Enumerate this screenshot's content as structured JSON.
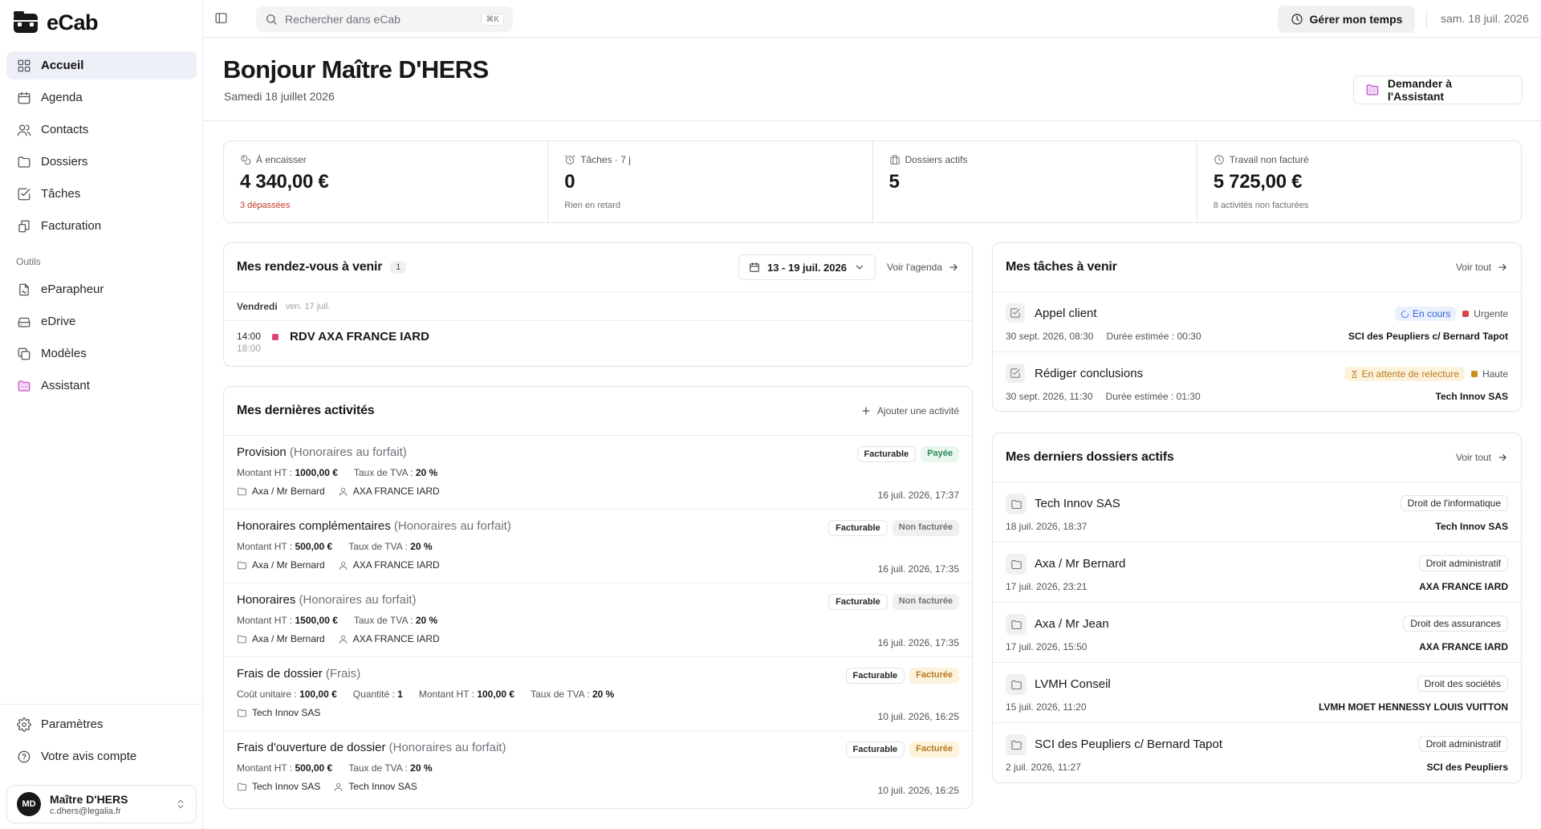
{
  "app": {
    "name": "eCab"
  },
  "sidebar": {
    "nav": [
      {
        "label": "Accueil",
        "icon": "dashboard-icon",
        "active": true
      },
      {
        "label": "Agenda",
        "icon": "calendar-icon"
      },
      {
        "label": "Contacts",
        "icon": "users-icon"
      },
      {
        "label": "Dossiers",
        "icon": "folder-icon"
      },
      {
        "label": "Tâches",
        "icon": "check-square-icon"
      },
      {
        "label": "Facturation",
        "icon": "invoice-icon"
      }
    ],
    "tools_label": "Outils",
    "tools": [
      {
        "label": "eParapheur",
        "icon": "signature-icon"
      },
      {
        "label": "eDrive",
        "icon": "drive-icon"
      },
      {
        "label": "Modèles",
        "icon": "copy-icon"
      },
      {
        "label": "Assistant",
        "icon": "assistant-icon"
      }
    ],
    "bottom": [
      {
        "label": "Paramètres",
        "icon": "gear-icon"
      },
      {
        "label": "Votre avis compte",
        "icon": "help-circle-icon"
      }
    ],
    "user": {
      "initials": "MD",
      "name": "Maître D'HERS",
      "email": "c.dhers@legalia.fr"
    }
  },
  "topbar": {
    "search_placeholder": "Rechercher dans eCab",
    "search_shortcut": "⌘K",
    "time_button": "Gérer mon temps",
    "date": "sam. 18 juil. 2026"
  },
  "header": {
    "title": "Bonjour Maître D'HERS",
    "subtitle": "Samedi 18 juillet 2026",
    "assistant_button": "Demander à l'Assistant"
  },
  "stats": [
    {
      "label": "À encaisser",
      "value": "4 340,00 €",
      "sub": "3 dépassées",
      "sub_style": "danger",
      "icon": "coins-icon"
    },
    {
      "label": "Tâches · 7 j",
      "value": "0",
      "sub": "Rien en retard",
      "sub_style": "normal",
      "icon": "alarm-clock-icon"
    },
    {
      "label": "Dossiers actifs",
      "value": "5",
      "sub": "",
      "sub_style": "normal",
      "icon": "briefcase-icon"
    },
    {
      "label": "Travail non facturé",
      "value": "5 725,00 €",
      "sub": "8 activités non facturées",
      "sub_style": "normal",
      "icon": "clock-icon"
    }
  ],
  "appointments": {
    "title": "Mes rendez-vous à venir",
    "count": "1",
    "range": "13 - 19 juil. 2026",
    "link": "Voir l'agenda",
    "day_name": "Vendredi",
    "day_date": "ven. 17 juil.",
    "items": [
      {
        "start": "14:00",
        "end": "18:00",
        "title": "RDV AXA FRANCE IARD",
        "color": "#e0457b"
      }
    ]
  },
  "activities": {
    "title": "Mes dernières activités",
    "add_label": "Ajouter une activité",
    "items": [
      {
        "title": "Provision",
        "type": "(Honoraires au forfait)",
        "meta": [
          {
            "k": "Montant HT :",
            "v": "1000,00 €"
          },
          {
            "k": "Taux de TVA :",
            "v": "20 %"
          }
        ],
        "dossier": "Axa / Mr Bernard",
        "client": "AXA FRANCE IARD",
        "badge1": "Facturable",
        "badge2": "Payée",
        "badge2_style": "paid",
        "date": "16 juil. 2026, 17:37"
      },
      {
        "title": "Honoraires complémentaires",
        "type": "(Honoraires au forfait)",
        "meta": [
          {
            "k": "Montant HT :",
            "v": "500,00 €"
          },
          {
            "k": "Taux de TVA :",
            "v": "20 %"
          }
        ],
        "dossier": "Axa / Mr Bernard",
        "client": "AXA FRANCE IARD",
        "badge1": "Facturable",
        "badge2": "Non facturée",
        "badge2_style": "unbilled",
        "date": "16 juil. 2026, 17:35"
      },
      {
        "title": "Honoraires",
        "type": "(Honoraires au forfait)",
        "meta": [
          {
            "k": "Montant HT :",
            "v": "1500,00 €"
          },
          {
            "k": "Taux de TVA :",
            "v": "20 %"
          }
        ],
        "dossier": "Axa / Mr Bernard",
        "client": "AXA FRANCE IARD",
        "badge1": "Facturable",
        "badge2": "Non facturée",
        "badge2_style": "unbilled",
        "date": "16 juil. 2026, 17:35"
      },
      {
        "title": "Frais de dossier",
        "type": "(Frais)",
        "meta": [
          {
            "k": "Coût unitaire :",
            "v": "100,00 €"
          },
          {
            "k": "Quantité :",
            "v": "1"
          },
          {
            "k": "Montant HT :",
            "v": "100,00 €"
          },
          {
            "k": "Taux de TVA :",
            "v": "20 %"
          }
        ],
        "dossier": "Tech Innov SAS",
        "client": "",
        "badge1": "Facturable",
        "badge2": "Facturée",
        "badge2_style": "billed",
        "date": "10 juil. 2026, 16:25"
      },
      {
        "title": "Frais d'ouverture de dossier",
        "type": "(Honoraires au forfait)",
        "meta": [
          {
            "k": "Montant HT :",
            "v": "500,00 €"
          },
          {
            "k": "Taux de TVA :",
            "v": "20 %"
          }
        ],
        "dossier": "Tech Innov SAS",
        "client": "Tech Innov SAS",
        "badge1": "Facturable",
        "badge2": "Facturée",
        "badge2_style": "billed",
        "date": "10 juil. 2026, 16:25"
      }
    ]
  },
  "tasks": {
    "title": "Mes tâches à venir",
    "link": "Voir tout",
    "items": [
      {
        "title": "Appel client",
        "status": "En cours",
        "status_style": "blue",
        "status_icon": "spinner-icon",
        "priority": "Urgente",
        "priority_color": "#d64545",
        "due": "30 sept. 2026, 08:30",
        "duration": "Durée estimée : 00:30",
        "client": "SCI des Peupliers c/ Bernard Tapot"
      },
      {
        "title": "Rédiger conclusions",
        "status": "En attente de relecture",
        "status_style": "amber",
        "status_icon": "hourglass-icon",
        "priority": "Haute",
        "priority_color": "#c8901f",
        "due": "30 sept. 2026, 11:30",
        "duration": "Durée estimée : 01:30",
        "client": "Tech Innov SAS"
      }
    ]
  },
  "folders": {
    "title": "Mes derniers dossiers actifs",
    "link": "Voir tout",
    "items": [
      {
        "name": "Tech Innov SAS",
        "date": "18 juil. 2026, 18:37",
        "tag": "Droit de l'informatique",
        "client": "Tech Innov SAS"
      },
      {
        "name": "Axa / Mr Bernard",
        "date": "17 juil. 2026, 23:21",
        "tag": "Droit administratif",
        "client": "AXA FRANCE IARD"
      },
      {
        "name": "Axa / Mr Jean",
        "date": "17 juil. 2026, 15:50",
        "tag": "Droit des assurances",
        "client": "AXA FRANCE IARD"
      },
      {
        "name": "LVMH Conseil",
        "date": "15 juil. 2026, 11:20",
        "tag": "Droit des sociétés",
        "client": "LVMH MOET HENNESSY LOUIS VUITTON"
      },
      {
        "name": "SCI des Peupliers c/ Bernard Tapot",
        "date": "2 juil. 2026, 11:27",
        "tag": "Droit administratif",
        "client": "SCI des Peupliers"
      }
    ]
  }
}
